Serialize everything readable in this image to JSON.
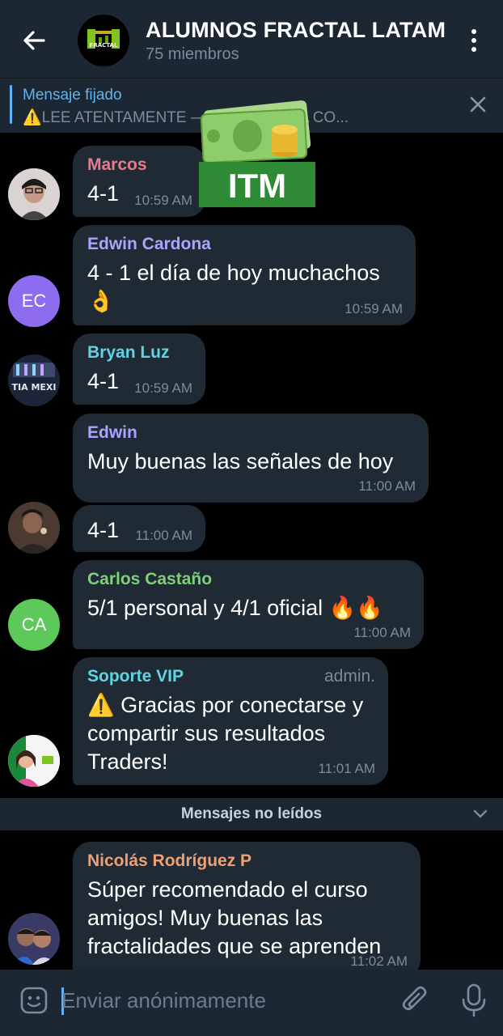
{
  "header": {
    "title": "ALUMNOS FRACTAL LATAM",
    "subtitle": "75 miembros",
    "logo_text": "FRACTAL"
  },
  "pinned": {
    "title": "Mensaje fijado",
    "text": "LEE ATENTAMENTE — DE NUESTRA CO...",
    "icon": "warning-icon"
  },
  "sticker": {
    "text": "ITM"
  },
  "messages": [
    {
      "sender": "Marcos",
      "sender_color": "#e67b8c",
      "text": "4-1",
      "time": "10:59 AM"
    },
    {
      "sender": "Edwin Cardona",
      "sender_color": "#a9a5ff",
      "initials": "EC",
      "avatar_color": "#8e6cf0",
      "text": "4 - 1 el día de hoy muchachos 👌",
      "time": "10:59 AM"
    },
    {
      "sender": "Bryan Luz",
      "sender_color": "#5fd4e3",
      "avatar_text": "TIA MEXI",
      "text": "4-1",
      "time": "10:59 AM"
    },
    {
      "sender": "Edwin",
      "sender_color": "#a9a5ff",
      "text": "Muy buenas las señales de hoy",
      "time": "11:00 AM"
    },
    {
      "text": "4-1",
      "time": "11:00 AM"
    },
    {
      "sender": "Carlos Castaño",
      "sender_color": "#7ed07a",
      "initials": "CA",
      "avatar_color": "#5cc95a",
      "text": "5/1 personal y 4/1 oficial 🔥🔥",
      "time": "11:00 AM"
    },
    {
      "sender": "Soporte VIP",
      "sender_color": "#5fd4e3",
      "badge": "admin.",
      "text": "⚠️ Gracias por conectarse y compartir sus resultados Traders!",
      "time": "11:01 AM"
    },
    {
      "sender": "Nicolás Rodríguez P",
      "sender_color": "#f0a070",
      "text": "Súper recomendado el curso amigos! Muy buenas las fractalidades que se aprenden",
      "time": "11:02 AM"
    }
  ],
  "unread_label": "Mensajes no leídos",
  "input": {
    "placeholder": "Enviar anónimamente"
  }
}
